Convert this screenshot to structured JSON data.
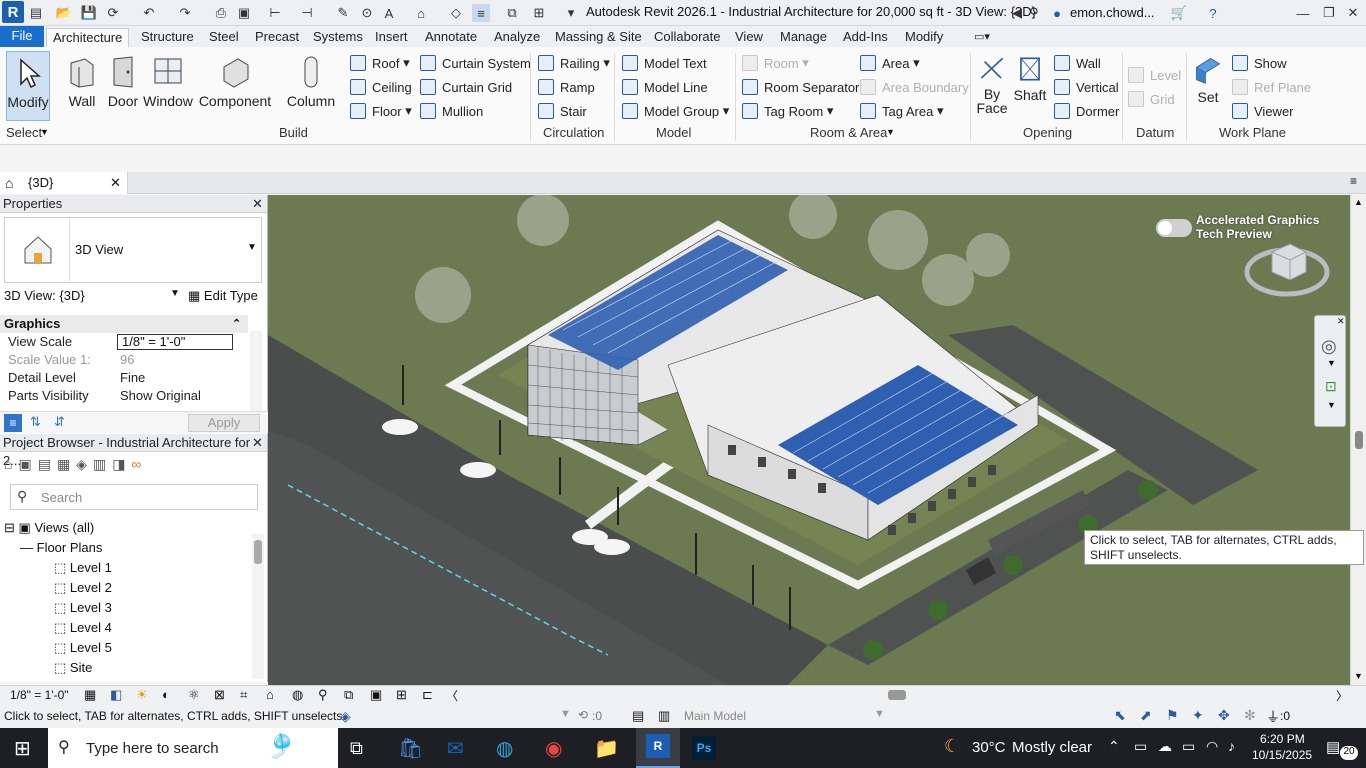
{
  "qat": {
    "title": "Autodesk Revit 2026.1 - Industrial Architecture for 20,000 sq ft - 3D View: {3D}",
    "user": "emon.chowd..."
  },
  "tabs": {
    "file": "File",
    "items": [
      "Architecture",
      "Structure",
      "Steel",
      "Precast",
      "Systems",
      "Insert",
      "Annotate",
      "Analyze",
      "Massing & Site",
      "Collaborate",
      "View",
      "Manage",
      "Add-Ins",
      "Modify"
    ]
  },
  "ribbon": {
    "modify": "Modify",
    "select": "Select",
    "wall": "Wall",
    "door": "Door",
    "window": "Window",
    "component": "Component",
    "column": "Column",
    "roof": "Roof",
    "ceiling": "Ceiling",
    "floor": "Floor",
    "curtain_system": "Curtain System",
    "curtain_grid": "Curtain Grid",
    "mullion": "Mullion",
    "build": "Build",
    "railing": "Railing",
    "ramp": "Ramp",
    "stair": "Stair",
    "circulation": "Circulation",
    "model_text": "Model Text",
    "model_line": "Model Line",
    "model_group": "Model Group",
    "model": "Model",
    "room": "Room",
    "room_separator": "Room Separator",
    "tag_room": "Tag Room",
    "area": "Area",
    "area_boundary": "Area Boundary",
    "tag_area": "Tag Area",
    "room_area": "Room & Area",
    "by_face": "By Face",
    "shaft": "Shaft",
    "wall_o": "Wall",
    "vertical": "Vertical",
    "dormer": "Dormer",
    "opening": "Opening",
    "level": "Level",
    "grid": "Grid",
    "datum": "Datum",
    "set": "Set",
    "show": "Show",
    "ref_plane": "Ref Plane",
    "viewer": "Viewer",
    "work_plane": "Work Plane"
  },
  "view_tab": {
    "label": "{3D}"
  },
  "properties": {
    "title": "Properties",
    "type": "3D View",
    "selector": "3D View: {3D}",
    "edit_type": "Edit Type",
    "section": "Graphics",
    "rows": [
      {
        "k": "View Scale",
        "v": "1/8\" = 1'-0\""
      },
      {
        "k": "Scale Value",
        "v": "96",
        "pre": "1:"
      },
      {
        "k": "Detail Level",
        "v": "Fine"
      },
      {
        "k": "Parts Visibility",
        "v": "Show Original"
      }
    ],
    "apply": "Apply"
  },
  "browser": {
    "title": "Project Browser - Industrial Architecture for 2...",
    "search": "Search",
    "views_all": "Views (all)",
    "floor_plans": "Floor Plans",
    "levels": [
      "Level 1",
      "Level 2",
      "Level 3",
      "Level 4",
      "Level 5",
      "Site"
    ]
  },
  "canvas": {
    "accel_line1": "Accelerated Graphics",
    "accel_line2": "Tech Preview"
  },
  "tooltip": "Click to select, TAB for alternates, CTRL adds, SHIFT unselects.",
  "status": {
    "scale": "1/8\" = 1'-0\"",
    "message": "Click to select, TAB for alternates, CTRL adds, SHIFT unselects.",
    "count1": ":0",
    "main_model": "Main Model",
    "filter_count": ":0"
  },
  "taskbar": {
    "search": "Type here to search",
    "weather_temp": "30°C",
    "weather_text": "Mostly clear",
    "time": "6:20 PM",
    "date": "10/15/2025",
    "notif": "20"
  },
  "colors": {
    "file_tab": "#1a6ecb",
    "grass": "#6d7b52",
    "roof_panels": "#2f5fb0"
  }
}
